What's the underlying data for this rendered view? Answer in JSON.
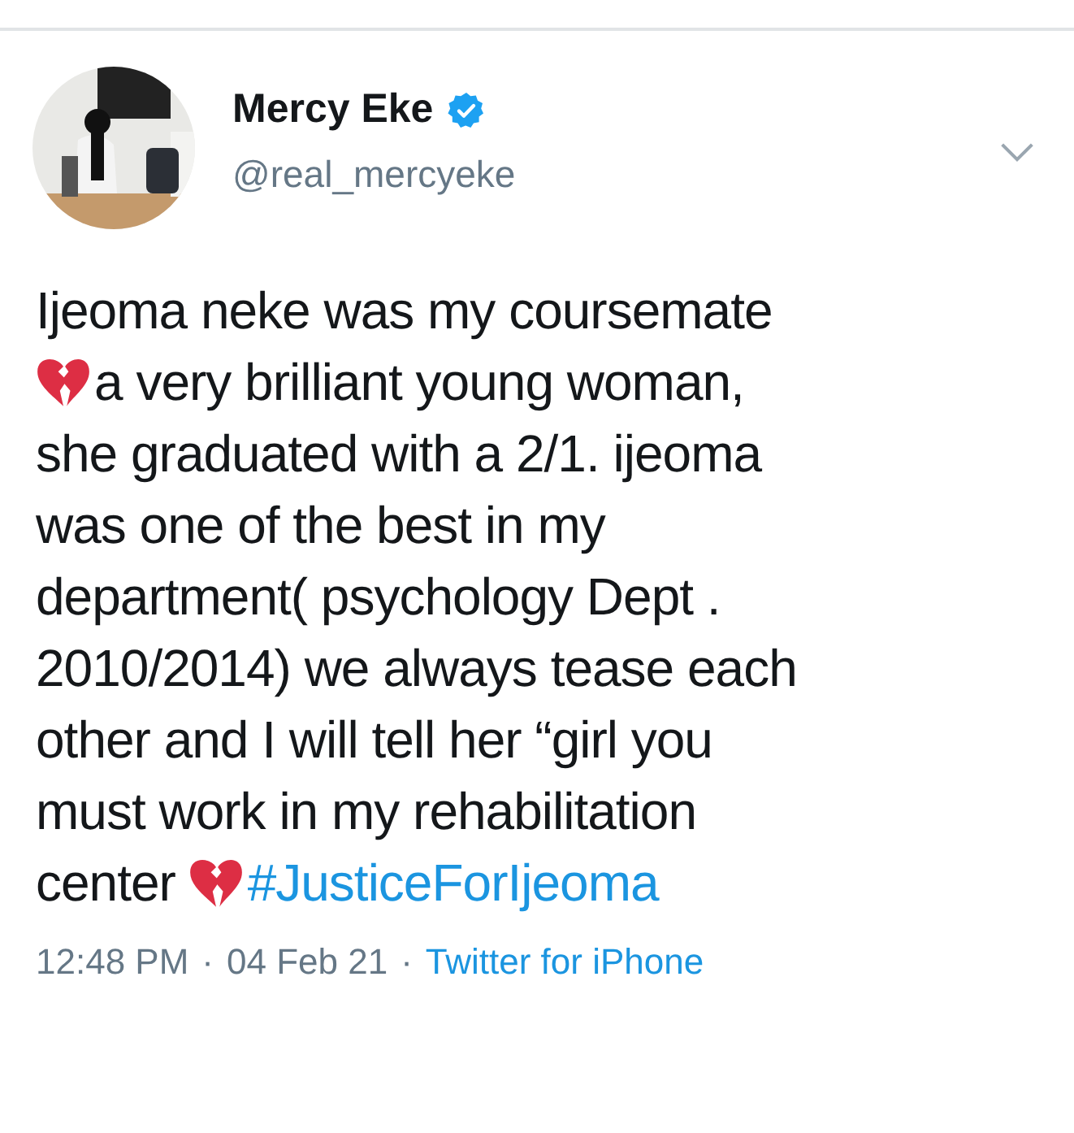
{
  "author": {
    "name": "Mercy Eke",
    "verified": true,
    "handle": "@real_mercyeke"
  },
  "body_lines": [
    [
      {
        "kind": "text",
        "text": "Ijeoma neke was my coursemate"
      }
    ],
    [
      {
        "kind": "emoji"
      },
      {
        "kind": "text",
        "text": "a very brilliant young woman,"
      }
    ],
    [
      {
        "kind": "text",
        "text": "she graduated with a 2/1. ijeoma"
      }
    ],
    [
      {
        "kind": "text",
        "text": "was one of the best in my"
      }
    ],
    [
      {
        "kind": "text",
        "text": "department( psychology Dept ."
      }
    ],
    [
      {
        "kind": "text",
        "text": "2010/2014) we always tease each"
      }
    ],
    [
      {
        "kind": "text",
        "text": "other and I will tell her “girl you"
      }
    ],
    [
      {
        "kind": "text",
        "text": "must work in my rehabilitation"
      }
    ],
    [
      {
        "kind": "text",
        "text": "center "
      },
      {
        "kind": "emoji"
      },
      {
        "kind": "hashtag",
        "text": "#JusticeForIjeoma"
      }
    ]
  ],
  "meta": {
    "time": "12:48 PM",
    "separator_1": "·",
    "date": "04 Feb 21",
    "separator_2": "·",
    "source": "Twitter for iPhone"
  }
}
